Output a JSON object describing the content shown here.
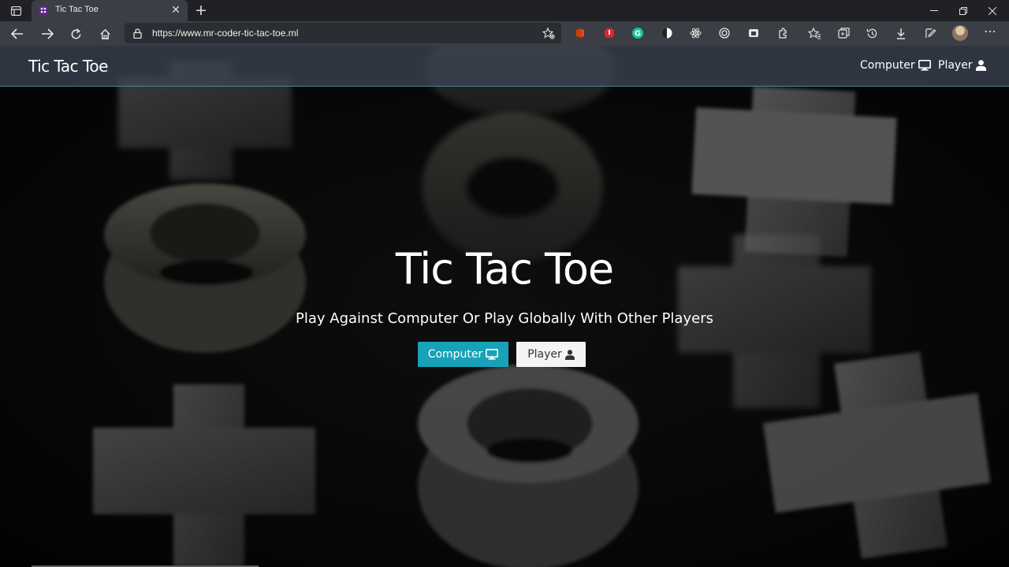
{
  "browser": {
    "tab_title": "Tic Tac Toe",
    "url": "https://www.mr-coder-tic-tac-toe.ml",
    "extensions": [
      "office-icon",
      "adblock-icon",
      "grammarly-icon",
      "dark-reader-icon",
      "react-devtools-icon",
      "screen-record-icon",
      "wappalyzer-icon",
      "extensions-icon"
    ],
    "colors": {
      "chrome": "#202124",
      "toolbar": "#3b3f45"
    }
  },
  "navbar": {
    "brand": "Tic Tac Toe",
    "links": [
      {
        "label": "Computer",
        "icon": "desktop-icon"
      },
      {
        "label": "Player",
        "icon": "user-icon"
      }
    ]
  },
  "hero": {
    "title": "Tic Tac Toe",
    "subtitle": "Play Against Computer Or Play Globally With Other Players",
    "buttons": [
      {
        "label": "Computer",
        "icon": "desktop-icon",
        "color": "#17a2b8"
      },
      {
        "label": "Player",
        "icon": "user-icon",
        "color": "#f4f4f4"
      }
    ]
  }
}
